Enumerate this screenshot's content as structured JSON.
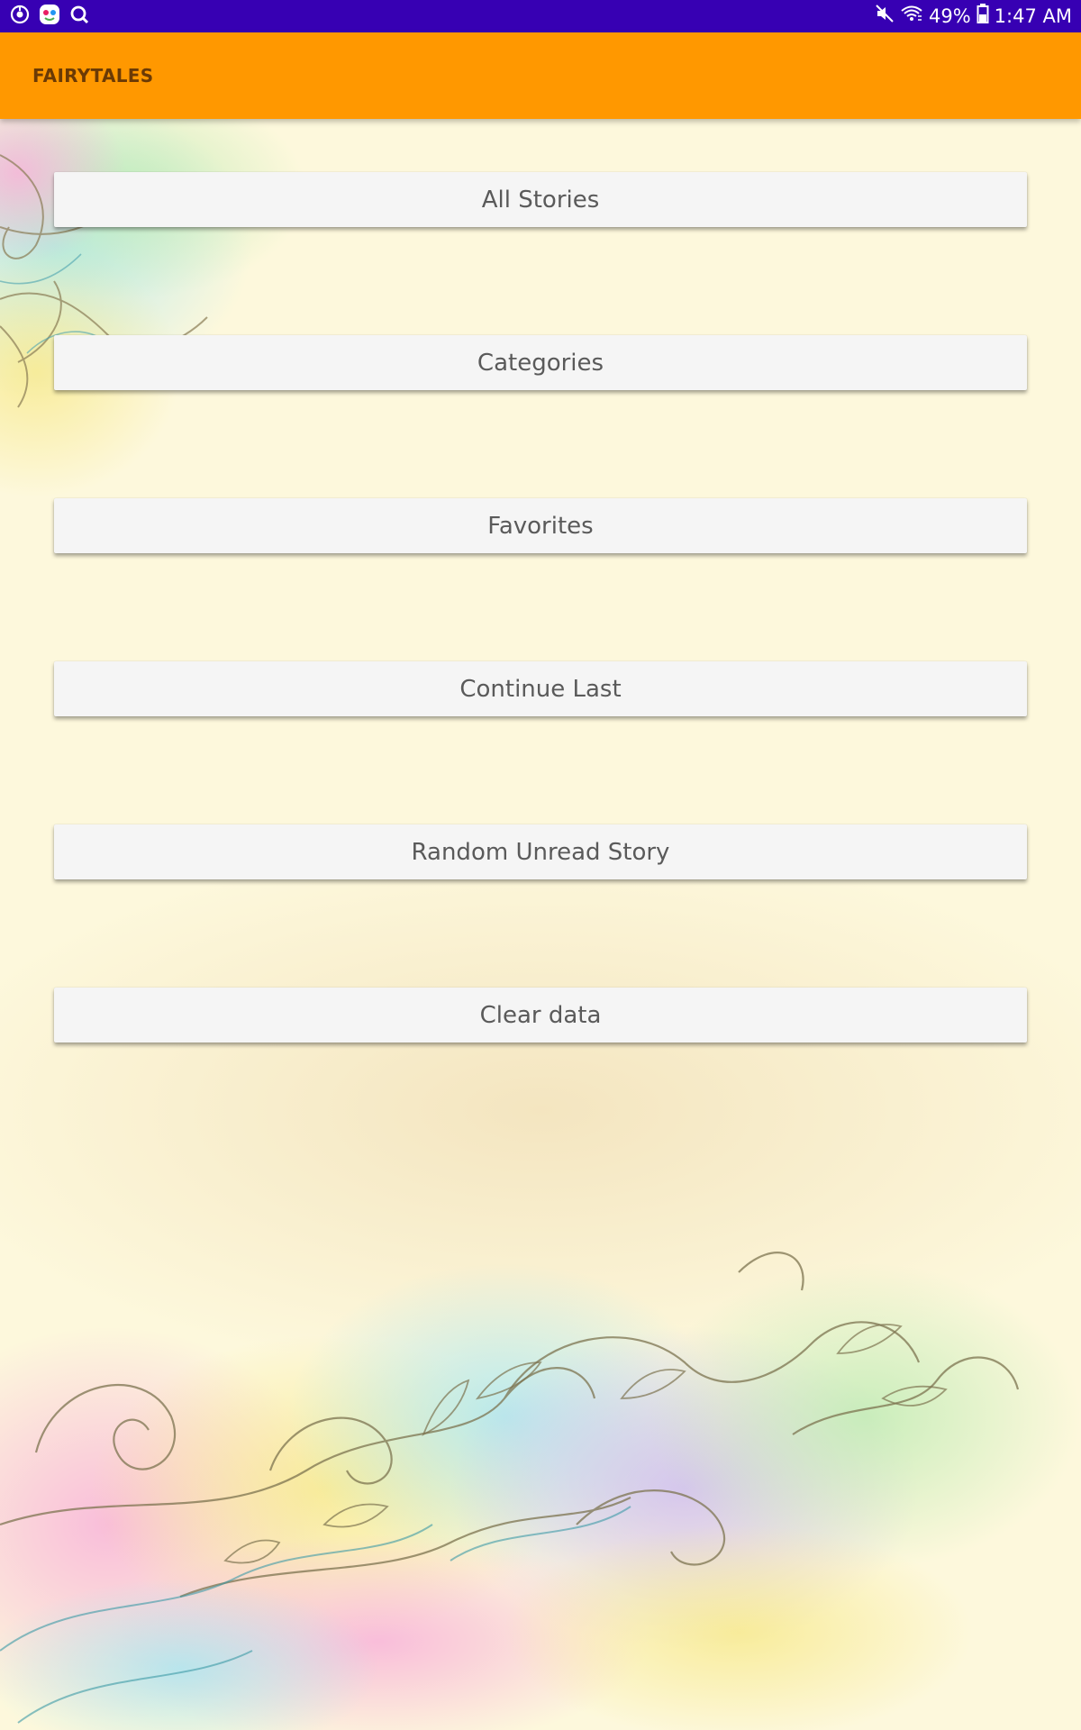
{
  "status_bar": {
    "left_icons": [
      "sync-icon",
      "app-face-icon",
      "quick-search-icon"
    ],
    "right_icons": [
      "mute-icon",
      "wifi-icon",
      "battery-icon"
    ],
    "battery": "49%",
    "time": "1:47 AM"
  },
  "app_bar": {
    "title": "FAIRYTALES"
  },
  "menu": {
    "all_stories": "All Stories",
    "categories": "Categories",
    "favorites": "Favorites",
    "continue_last": "Continue Last",
    "random_unread_story": "Random Unread Story",
    "clear_data": "Clear data"
  },
  "colors": {
    "status_bar": "#3700b3",
    "app_bar": "#ff9800",
    "background": "#fdf8dc",
    "button": "#f5f5f5"
  }
}
